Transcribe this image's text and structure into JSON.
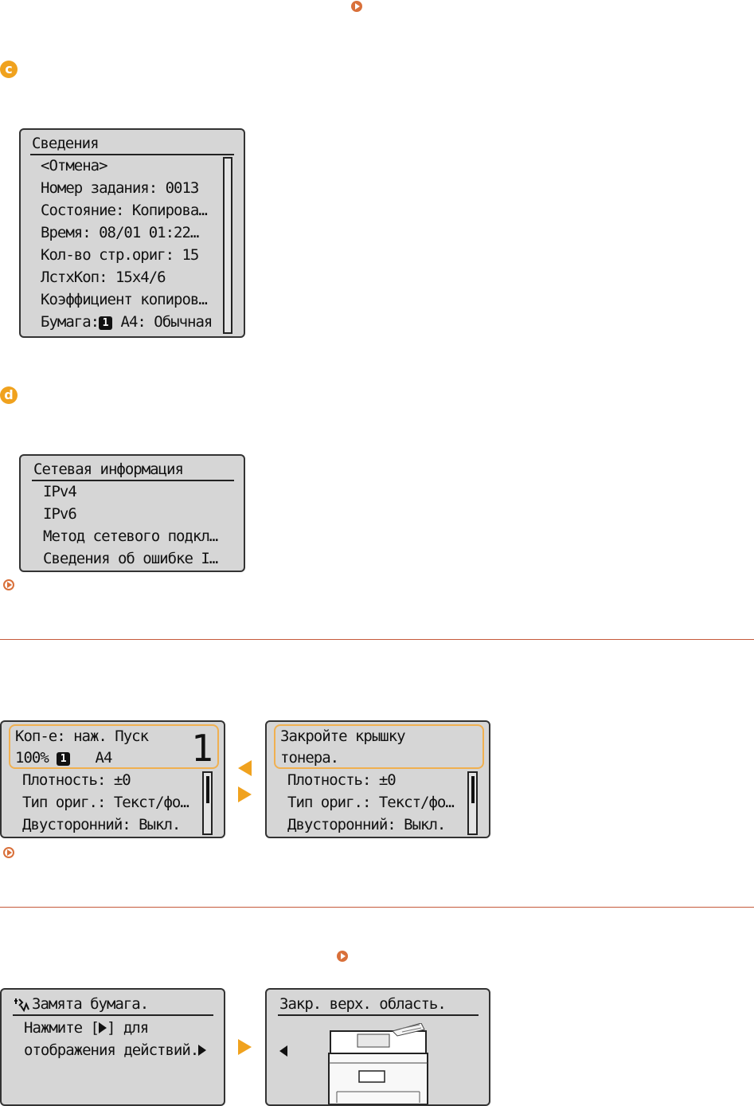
{
  "colors": {
    "accent": "#f0a21e",
    "link": "#d9703a",
    "lcd_bg": "#d6d6d6",
    "divider": "#c55a3a"
  },
  "steps": {
    "c": "c",
    "d": "d"
  },
  "details_screen": {
    "title": "Сведения",
    "items": [
      "<Отмена>",
      "Номер задания: 0013",
      "Состояние: Копирова…",
      "Время: 08/01 01:22…",
      "Кол-во стр.ориг: 15",
      "ЛстхКоп: 15x4/6",
      "Коэффициент копиров…"
    ],
    "paper_label": "Бумага:",
    "paper_tray": "1",
    "paper_value": "A4: Обычная"
  },
  "network_screen": {
    "title": "Сетевая информация",
    "items": [
      "IPv4",
      "IPv6",
      "Метод сетевого подкл…",
      "Сведения об ошибке I…"
    ]
  },
  "copy_screen": {
    "line1": "Коп-е: наж. Пуск",
    "zoom": "100%",
    "tray": "1",
    "paper": "A4",
    "copies": "1",
    "items": [
      "Плотность: ±0",
      "Тип ориг.: Текст/фо…",
      "Двусторонний: Выкл."
    ]
  },
  "toner_screen": {
    "message_line1": "Закройте крышку",
    "message_line2": "тонера.",
    "items": [
      "Плотность: ±0",
      "Тип ориг.: Текст/фо…",
      "Двусторонний: Выкл."
    ]
  },
  "jam_screen": {
    "title": "Замята бумага.",
    "line1": "Нажмите [",
    "line1_end": "] для",
    "line2": "отображения действий."
  },
  "top_area_screen": {
    "title": "Закр. верх. область."
  }
}
